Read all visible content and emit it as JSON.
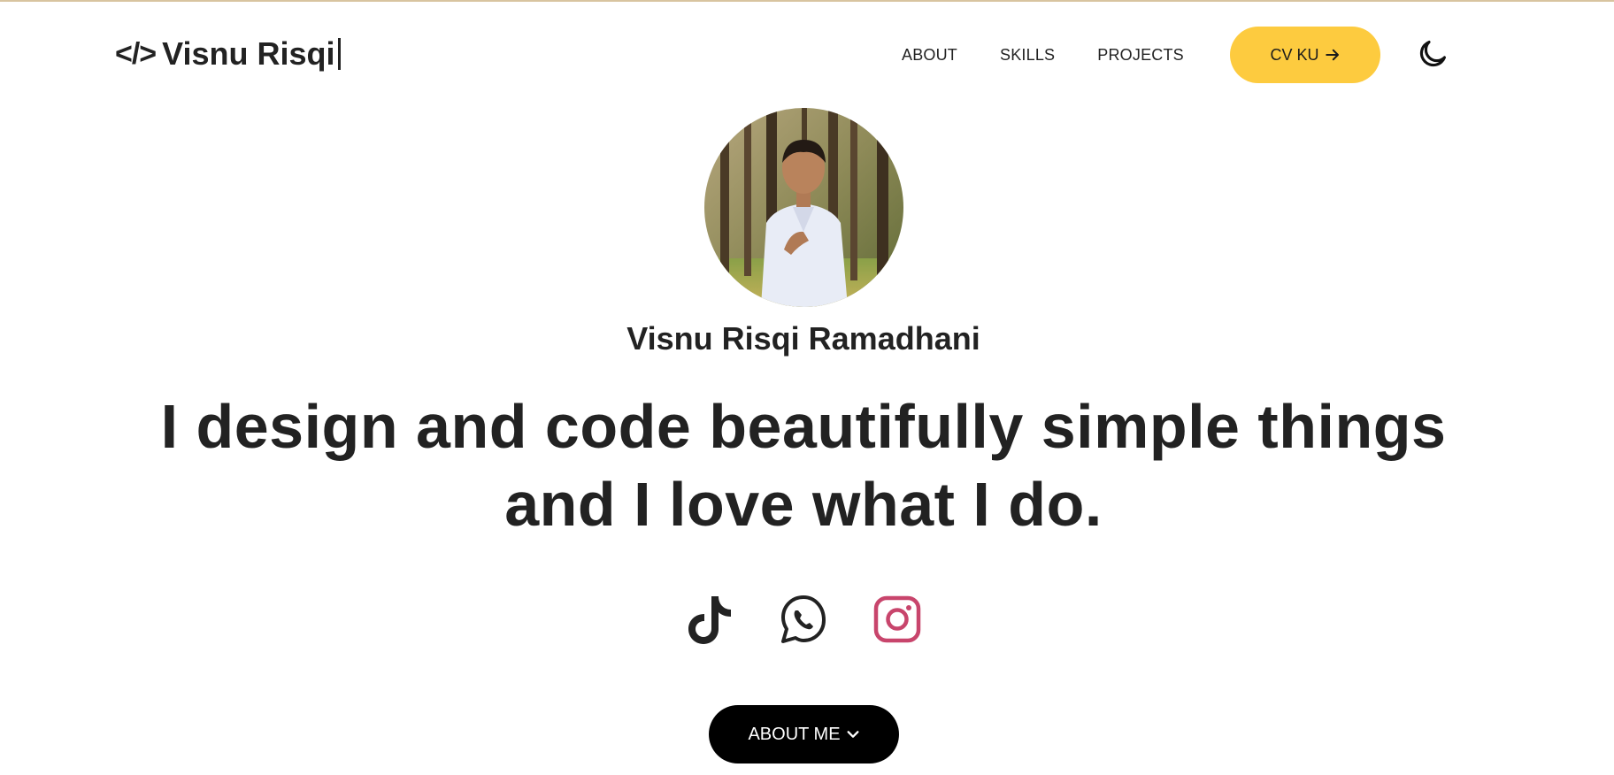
{
  "header": {
    "logo_glyph": "</>",
    "logo_text": "Visnu Risqi",
    "nav": [
      {
        "label": "ABOUT"
      },
      {
        "label": "SKILLS"
      },
      {
        "label": "PROJECTS"
      }
    ],
    "cv_label": "CV KU",
    "cv_icon": "arrow-right-icon",
    "theme_icon": "moon-icon"
  },
  "hero": {
    "name": "Visnu Risqi Ramadhani",
    "headline_line1": "I design and code beautifully simple things",
    "headline_line2": "and I love what I do.",
    "socials": [
      {
        "icon": "tiktok-icon"
      },
      {
        "icon": "whatsapp-icon"
      },
      {
        "icon": "instagram-icon"
      }
    ],
    "about_label": "ABOUT ME",
    "about_icon": "chevron-down-icon"
  },
  "colors": {
    "accent": "#fdcb3f",
    "text": "#222222",
    "instagram": "#c8456c",
    "button_dark": "#000000"
  }
}
